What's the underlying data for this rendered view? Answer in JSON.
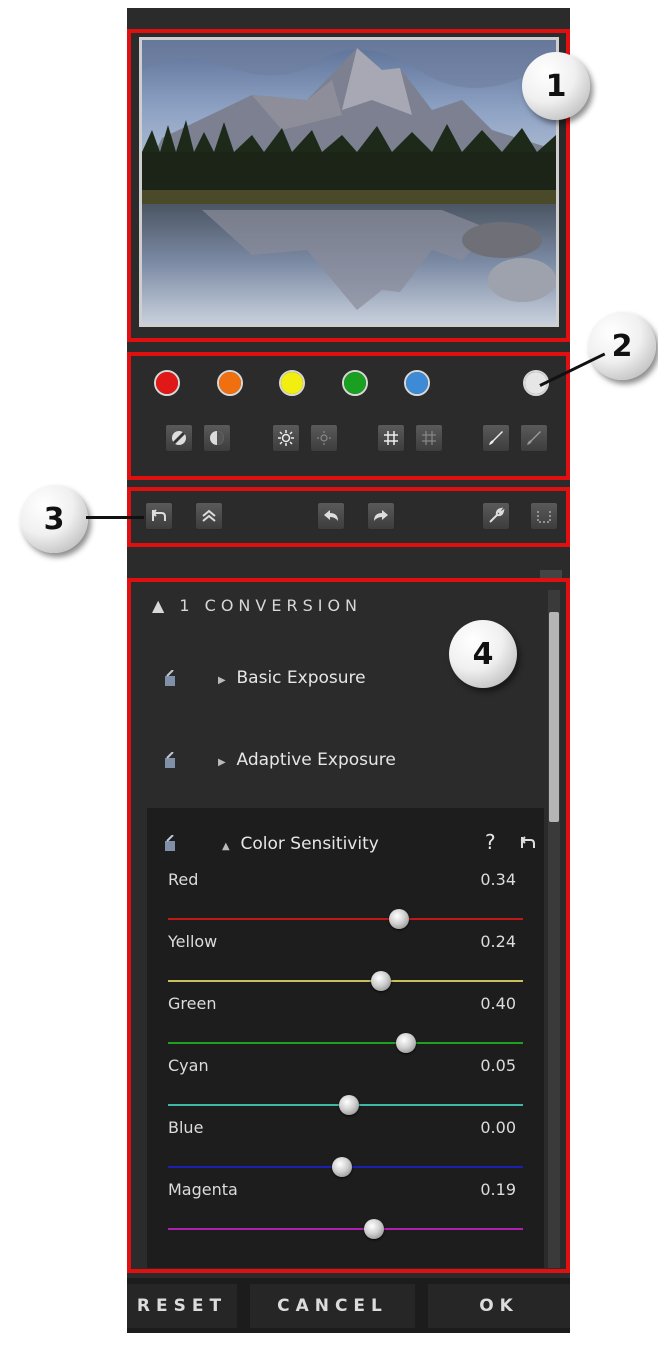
{
  "callouts": [
    "1",
    "2",
    "3",
    "4"
  ],
  "colors": {
    "red": "#e01818",
    "orange": "#f07010",
    "yellow": "#f2ee10",
    "green": "#1aa020",
    "blue": "#3d8ad6",
    "white": "#e6e6e6"
  },
  "toolbar_icons": [
    "contrast-minus-icon",
    "contrast-plus-icon",
    "brightness-plus-icon",
    "brightness-minus-icon",
    "structure-plus-icon",
    "structure-minus-icon",
    "brush-icon",
    "eraser-icon"
  ],
  "history_icons": [
    "reset-step-icon",
    "collapse-icon",
    "undo-icon",
    "redo-icon",
    "settings-icon",
    "compare-icon"
  ],
  "section": {
    "title": "1 CONVERSION"
  },
  "rows": {
    "basic": "Basic Exposure",
    "adaptive": "Adaptive Exposure",
    "color_sensitivity": "Color Sensitivity",
    "help": "?"
  },
  "sliders": [
    {
      "label": "Red",
      "value": "0.34",
      "color": "#c01818",
      "pos": 0.65
    },
    {
      "label": "Yellow",
      "value": "0.24",
      "color": "#c8c05a",
      "pos": 0.6
    },
    {
      "label": "Green",
      "value": "0.40",
      "color": "#20a020",
      "pos": 0.67
    },
    {
      "label": "Cyan",
      "value": "0.05",
      "color": "#40b8a8",
      "pos": 0.51
    },
    {
      "label": "Blue",
      "value": "0.00",
      "color": "#1c20b0",
      "pos": 0.49
    },
    {
      "label": "Magenta",
      "value": "0.19",
      "color": "#b020b0",
      "pos": 0.58
    }
  ],
  "buttons": {
    "reset": "RESET",
    "cancel": "CANCEL",
    "ok": "OK"
  }
}
